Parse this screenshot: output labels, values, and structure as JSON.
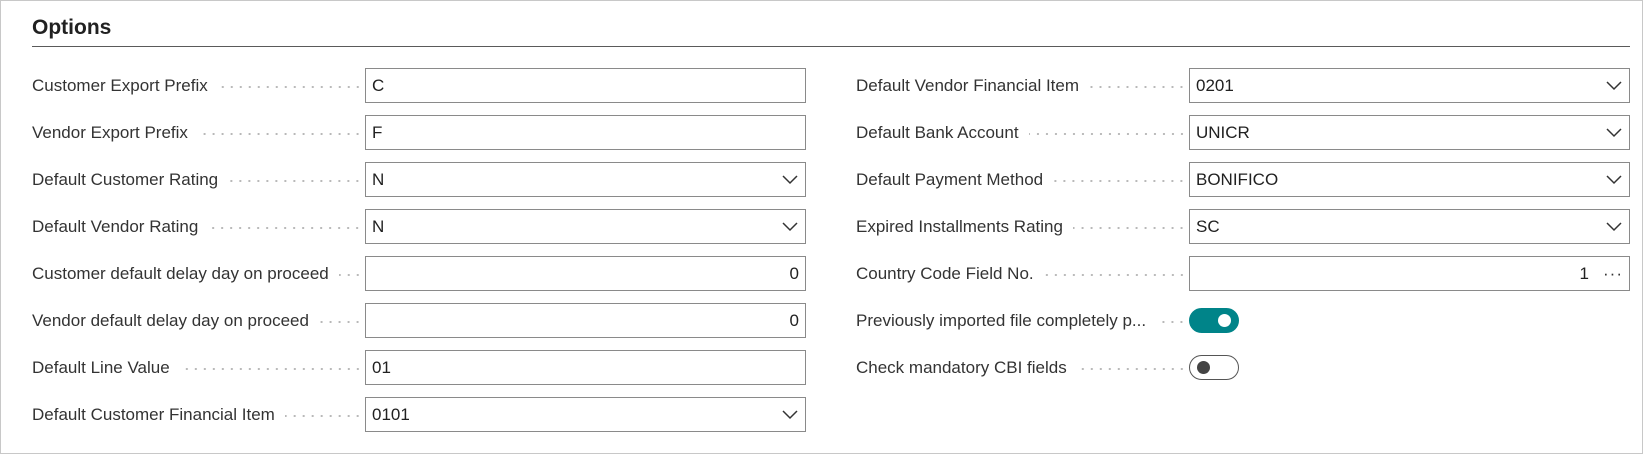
{
  "section": {
    "title": "Options"
  },
  "left_fields": [
    {
      "label": "Customer Export Prefix",
      "value": "C",
      "kind": "text"
    },
    {
      "label": "Vendor Export Prefix",
      "value": "F",
      "kind": "text"
    },
    {
      "label": "Default Customer Rating",
      "value": "N",
      "kind": "dropdown"
    },
    {
      "label": "Default Vendor Rating",
      "value": "N",
      "kind": "dropdown"
    },
    {
      "label": "Customer default delay day on proceed",
      "value": "0",
      "kind": "number"
    },
    {
      "label": "Vendor default delay day on proceed",
      "value": "0",
      "kind": "number"
    },
    {
      "label": "Default Line Value",
      "value": "01",
      "kind": "text"
    },
    {
      "label": "Default Customer Financial Item",
      "value": "0101",
      "kind": "dropdown"
    }
  ],
  "right_fields": [
    {
      "label": "Default Vendor Financial Item",
      "value": "0201",
      "kind": "dropdown"
    },
    {
      "label": "Default Bank Account",
      "value": "UNICR",
      "kind": "dropdown"
    },
    {
      "label": "Default Payment Method",
      "value": "BONIFICO",
      "kind": "dropdown"
    },
    {
      "label": "Expired Installments Rating",
      "value": "SC",
      "kind": "dropdown"
    },
    {
      "label": "Country Code Field No.",
      "value": "1",
      "kind": "lookup",
      "lookup_glyph": "···"
    },
    {
      "label": "Previously imported file completely p...",
      "kind": "toggle",
      "state": "on"
    },
    {
      "label": "Check mandatory CBI fields",
      "kind": "toggle",
      "state": "off"
    }
  ],
  "colors": {
    "toggle_on": "#008489",
    "border": "#8a8a8a",
    "text": "#212121"
  }
}
